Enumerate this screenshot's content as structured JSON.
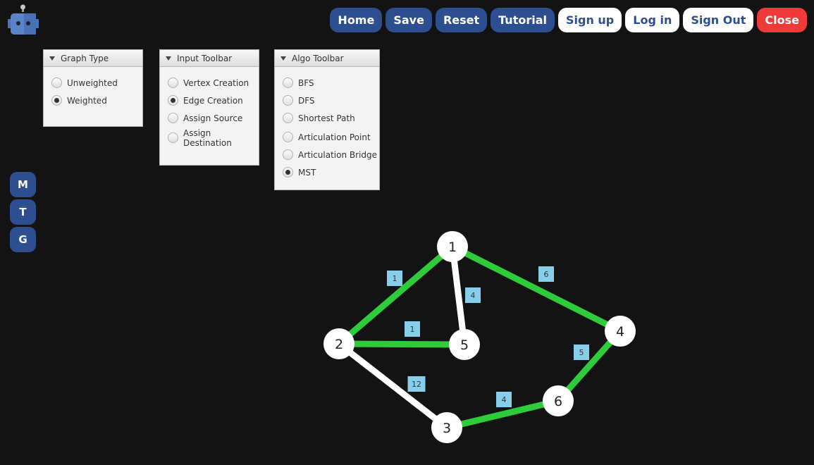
{
  "header": {
    "buttons": [
      {
        "label": "Home",
        "style": "blue"
      },
      {
        "label": "Save",
        "style": "blue"
      },
      {
        "label": "Reset",
        "style": "blue"
      },
      {
        "label": "Tutorial",
        "style": "blue"
      },
      {
        "label": "Sign up",
        "style": "white"
      },
      {
        "label": "Log in",
        "style": "white"
      },
      {
        "label": "Sign Out",
        "style": "white"
      },
      {
        "label": "Close",
        "style": "red"
      }
    ]
  },
  "sidebar": {
    "buttons": [
      {
        "label": "M"
      },
      {
        "label": "T"
      },
      {
        "label": "G"
      }
    ]
  },
  "panels": {
    "graph_type": {
      "title": "Graph Type",
      "options": [
        {
          "label": "Unweighted",
          "checked": false
        },
        {
          "label": "Weighted",
          "checked": true
        }
      ]
    },
    "input_toolbar": {
      "title": "Input Toolbar",
      "options": [
        {
          "label": "Vertex Creation",
          "checked": false
        },
        {
          "label": "Edge Creation",
          "checked": true
        },
        {
          "label": "Assign Source",
          "checked": false
        },
        {
          "label": "Assign Destination",
          "checked": false
        }
      ]
    },
    "algo_toolbar": {
      "title": "Algo Toolbar",
      "options": [
        {
          "label": "BFS",
          "checked": false
        },
        {
          "label": "DFS",
          "checked": false
        },
        {
          "label": "Shortest Path",
          "checked": false
        },
        {
          "label": "Articulation Point",
          "checked": false
        },
        {
          "label": "Articulation Bridge",
          "checked": false
        },
        {
          "label": "MST",
          "checked": true
        }
      ]
    }
  },
  "graph": {
    "nodes": [
      {
        "id": "1"
      },
      {
        "id": "2"
      },
      {
        "id": "3"
      },
      {
        "id": "4"
      },
      {
        "id": "5"
      },
      {
        "id": "6"
      }
    ],
    "edges": [
      {
        "from": "1",
        "to": "2",
        "weight": "1",
        "in_mst": true
      },
      {
        "from": "1",
        "to": "5",
        "weight": "4",
        "in_mst": false
      },
      {
        "from": "1",
        "to": "4",
        "weight": "6",
        "in_mst": true
      },
      {
        "from": "2",
        "to": "5",
        "weight": "1",
        "in_mst": true
      },
      {
        "from": "2",
        "to": "3",
        "weight": "12",
        "in_mst": false
      },
      {
        "from": "3",
        "to": "6",
        "weight": "4",
        "in_mst": true
      },
      {
        "from": "6",
        "to": "4",
        "weight": "5",
        "in_mst": true
      }
    ]
  },
  "colors": {
    "background": "#131313",
    "primary_blue": "#2e4f8f",
    "close_red": "#f03a3a",
    "mst_edge": "#2ecc3a",
    "normal_edge": "#ffffff",
    "weight_label_bg": "#87ceeb"
  }
}
